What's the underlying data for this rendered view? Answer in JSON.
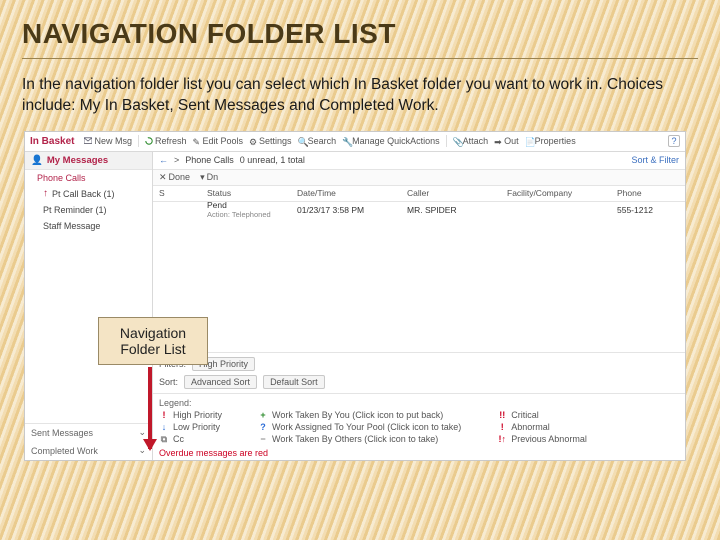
{
  "slide": {
    "title": "NAVIGATION FOLDER LIST",
    "description": "In the navigation folder list you can select which In Basket folder you want to work in. Choices include: My In Basket, Sent Messages and Completed Work."
  },
  "callout": {
    "text": "Navigation Folder List"
  },
  "toolbar": {
    "app_label": "In Basket",
    "buttons": {
      "new": "New Msg",
      "refresh": "Refresh",
      "edit_pools": "Edit Pools",
      "settings": "Settings",
      "search": "Search",
      "quick_actions": "Manage QuickActions",
      "attach": "Attach",
      "out": "Out",
      "properties": "Properties"
    },
    "help": "?"
  },
  "nav": {
    "heading": "My Messages",
    "items": [
      {
        "label": "Phone Calls"
      },
      {
        "label": "Pt Call Back (1)"
      },
      {
        "label": "Pt Reminder (1)"
      },
      {
        "label": "Staff Message"
      }
    ],
    "footer": [
      {
        "label": "Sent Messages"
      },
      {
        "label": "Completed Work"
      }
    ]
  },
  "content": {
    "back": "←",
    "breadcrumb_icon": ">",
    "folder_name": "Phone Calls",
    "counts": "0 unread, 1 total",
    "sort_filter": "Sort & Filter",
    "listbar": {
      "done": "Done",
      "dn": "Dn"
    },
    "columns": {
      "s": "S",
      "status": "Status",
      "datetime": "Date/Time",
      "caller": "Caller",
      "facility": "Facility/Company",
      "phone": "Phone"
    },
    "rows": [
      {
        "s": "",
        "status": "Pend",
        "sub": "Action: Telephoned",
        "datetime": "01/23/17  3:58 PM",
        "caller": "MR. SPIDER",
        "facility": "",
        "phone": "555-1212"
      }
    ],
    "filters": {
      "label": "Filters:",
      "high_priority": "High Priority",
      "sort_label": "Sort:",
      "advanced_sort": "Advanced Sort",
      "default_sort": "Default Sort"
    },
    "legend": {
      "heading": "Legend:",
      "col1": [
        {
          "mark": "!",
          "cls": "red",
          "text": "High Priority"
        },
        {
          "mark": "↓",
          "cls": "blue",
          "text": "Low Priority"
        },
        {
          "mark": "⧉",
          "cls": "gry",
          "text": "Cc"
        }
      ],
      "col2": [
        {
          "mark": "+",
          "cls": "grn",
          "text": "Work Taken By You (Click icon to put back)"
        },
        {
          "mark": "?",
          "cls": "blue",
          "text": "Work Assigned To Your Pool (Click icon to take)"
        },
        {
          "mark": "−",
          "cls": "gry",
          "text": "Work Taken By Others (Click icon to take)"
        }
      ],
      "col3": [
        {
          "mark": "!!",
          "cls": "red",
          "text": "Critical"
        },
        {
          "mark": "!",
          "cls": "red",
          "text": "Abnormal"
        },
        {
          "mark": "!↑",
          "cls": "red",
          "text": "Previous Abnormal"
        }
      ],
      "overdue": "Overdue messages are red"
    }
  }
}
